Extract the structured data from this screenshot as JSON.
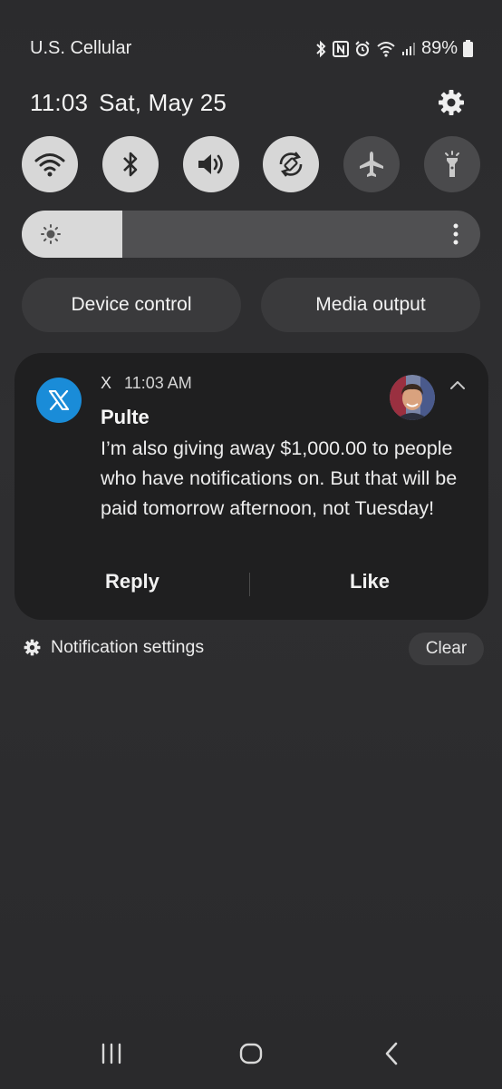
{
  "status_bar": {
    "carrier": "U.S. Cellular",
    "battery": "89%",
    "icons": [
      "bluetooth-icon",
      "nfc-icon",
      "alarm-icon",
      "wifi-icon",
      "signal-icon",
      "battery-icon"
    ]
  },
  "header": {
    "time": "11:03",
    "date": "Sat, May 25",
    "settings_icon": "gear-icon"
  },
  "quick_settings": {
    "tiles": [
      {
        "name": "wifi",
        "icon": "wifi-icon",
        "state": "on"
      },
      {
        "name": "bluetooth",
        "icon": "bluetooth-icon",
        "state": "on"
      },
      {
        "name": "sound",
        "icon": "volume-icon",
        "state": "on"
      },
      {
        "name": "auto-rotate",
        "icon": "rotate-icon",
        "state": "on"
      },
      {
        "name": "airplane-mode",
        "icon": "airplane-icon",
        "state": "off"
      },
      {
        "name": "flashlight",
        "icon": "flashlight-icon",
        "state": "off"
      }
    ],
    "brightness_level": 0.22
  },
  "buttons": {
    "device_control": "Device control",
    "media_output": "Media output"
  },
  "notification": {
    "app": "X",
    "time": "11:03 AM",
    "sender": "Pulte",
    "message": "I’m also giving away $1,000.00 to people who have notifications on. But that will be paid tomorrow afternoon, not Tuesday!",
    "actions": {
      "reply": "Reply",
      "like": "Like"
    },
    "app_color": "#1a8cd8"
  },
  "footer": {
    "notification_settings": "Notification settings",
    "clear": "Clear"
  },
  "colors": {
    "background": "#2d2d2f",
    "card": "#1f1f20",
    "tile_on": "#d7d7d7",
    "tile_off": "#4a4a4c",
    "accent_blue": "#1a8cd8"
  }
}
